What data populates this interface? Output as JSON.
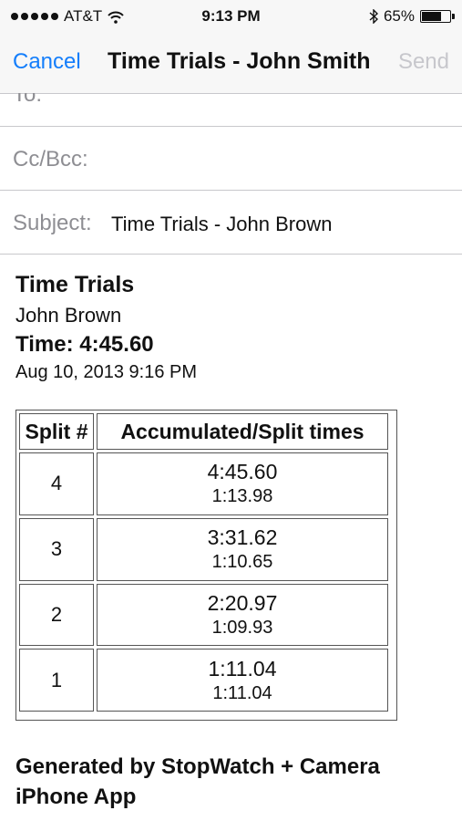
{
  "status_bar": {
    "carrier": "AT&T",
    "time": "9:13 PM",
    "battery_text": "65%",
    "battery_level": 0.65,
    "signal_bars": 5,
    "icons": [
      "signal-dots-icon",
      "wifi-icon",
      "bluetooth-icon",
      "battery-icon"
    ]
  },
  "nav": {
    "cancel_label": "Cancel",
    "title": "Time Trials - John Smith",
    "send_label": "Send"
  },
  "fields": {
    "to_label": "To:",
    "cc_label": "Cc/Bcc:",
    "subject_label": "Subject:",
    "subject_value": "Time Trials - John Brown"
  },
  "body": {
    "title": "Time Trials",
    "name": "John Brown",
    "time_line": "Time: 4:45.60",
    "date": "Aug 10, 2013 9:16 PM",
    "table": {
      "headers": [
        "Split #",
        "Accumulated/Split times"
      ],
      "rows": [
        {
          "split": "4",
          "accumulated": "4:45.60",
          "split_time": "1:13.98"
        },
        {
          "split": "3",
          "accumulated": "3:31.62",
          "split_time": "1:10.65"
        },
        {
          "split": "2",
          "accumulated": "2:20.97",
          "split_time": "1:09.93"
        },
        {
          "split": "1",
          "accumulated": "1:11.04",
          "split_time": "1:11.04"
        }
      ]
    },
    "footer_line1": "Generated by StopWatch + Camera",
    "footer_line2": "iPhone App"
  },
  "colors": {
    "accent": "#147efb",
    "disabled": "#c7c7cc",
    "label_gray": "#8e8e93",
    "bar_bg": "#f7f7f7"
  }
}
